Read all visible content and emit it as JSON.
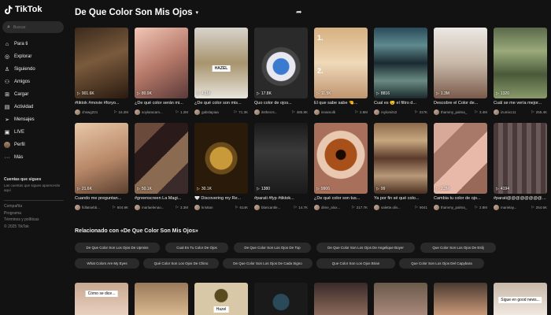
{
  "app": {
    "name": "TikTok"
  },
  "search": {
    "placeholder": "Buscar"
  },
  "sidebar": {
    "items": [
      {
        "label": "Para ti",
        "icon": "home-icon"
      },
      {
        "label": "Explorar",
        "icon": "compass-icon"
      },
      {
        "label": "Siguiendo",
        "icon": "following-icon"
      },
      {
        "label": "Amigos",
        "icon": "friends-icon"
      },
      {
        "label": "Cargar",
        "icon": "upload-icon"
      },
      {
        "label": "Actividad",
        "icon": "activity-icon"
      },
      {
        "label": "Mensajes",
        "icon": "messages-icon"
      },
      {
        "label": "LIVE",
        "icon": "live-icon"
      },
      {
        "label": "Perfil",
        "icon": "profile-avatar"
      },
      {
        "label": "Más",
        "icon": "more-icon"
      }
    ],
    "following_title": "Cuentas que sigues",
    "following_note": "Las cuentas que sigues aparecerán aquí",
    "footer": [
      "Compañía",
      "Programa",
      "Términos y políticas",
      "© 2025 TikTok"
    ]
  },
  "header": {
    "title": "De Que Color Son Mis Ojos"
  },
  "videos_row1": [
    {
      "views": "901.6K",
      "caption": "#tiktok #movie #foryo...",
      "user": "chswg221",
      "likes": "16.2M"
    },
    {
      "views": "80.9K",
      "caption": "¿De qué color serán mi...",
      "user": "soylaracam...",
      "likes": "1.2M"
    },
    {
      "views": "4.1M",
      "caption": "¿De qué color son mis...",
      "user": "gabslapiaa",
      "likes": "71.3K"
    },
    {
      "views": "17.8K",
      "caption": "Quo color de ojos...",
      "user": "itsthecrs...",
      "likes": "485.8K"
    },
    {
      "views": "11.5K",
      "caption": "El que sabe sabe 🤏...",
      "user": "innamolb",
      "likes": "2.8M"
    },
    {
      "views": "8816",
      "caption": "Cual es 😉 el filtro d...",
      "user": "rxylomits2",
      "likes": "317K"
    },
    {
      "views": "1.3M",
      "caption": "Descobre el Color de...",
      "user": "thammy_palma_",
      "likes": "3.4M"
    },
    {
      "views": "1320",
      "caption": "Cuál se me vería mejor...",
      "user": "izumixc11",
      "likes": "255.4K"
    }
  ],
  "videos_row2": [
    {
      "views": "21.6K",
      "caption": "Cuando me preguntan...",
      "user": "fidlatsebb...",
      "likes": "604.9K"
    },
    {
      "views": "50.1K",
      "caption": "#greenscreen La Magi...",
      "user": "marlaelenao...",
      "likes": "3.3M"
    },
    {
      "views": "30.1K",
      "caption": "🤍 Discovering my Re...",
      "user": "kris8an",
      "likes": "614K"
    },
    {
      "views": "1380",
      "caption": "#parati #fyp #tiktok...",
      "user": "blancantle...",
      "likes": "14.7K"
    },
    {
      "views": "9906",
      "caption": "¿De qué color son tus...",
      "user": "dime_alox...",
      "likes": "217.7K"
    },
    {
      "views": "99",
      "caption": "Ya por fin sé qué colo...",
      "user": "salette.oliv...",
      "likes": "9041"
    },
    {
      "views": "2.3M",
      "caption": "Cambia tu color de ojo...",
      "user": "thammy_palma_",
      "likes": "2.8M"
    },
    {
      "views": "4194",
      "caption": "#parati@@@@@@@@@@...",
      "user": "marielay...",
      "likes": "254.6K"
    }
  ],
  "related": {
    "title": "Relacionado con «De Que Color Son Mis Ojos»",
    "chips": [
      "De Que Color Son Los Ojos De Upmiss",
      "Cual Es Tu Color De Ojos",
      "De Que Color Son Los Ojos De Top",
      "De Que Color Son Los Ojos De Angelique Boyer",
      "Que Color Son Los Ojos De Eslij",
      "What Colors Are My Eyes",
      "Qué Color Son Los Ojos De Chino",
      "De Que Color Son Los Ojos De Cada Signo",
      "Que Color Son Los Ojos Brian",
      "Que Color Son Los Ojos Del Capybara"
    ]
  },
  "row3_labels": {
    "first": "Cómo se dice...",
    "second": "Hazel",
    "eighth": "Sigue en good news..."
  },
  "thumb_labels": {
    "hazel": "HAZEL",
    "one": "1.",
    "two": "2."
  },
  "colors": {
    "background": "#121212",
    "chip": "#2a2a2a",
    "accent": "#fe2c55"
  }
}
